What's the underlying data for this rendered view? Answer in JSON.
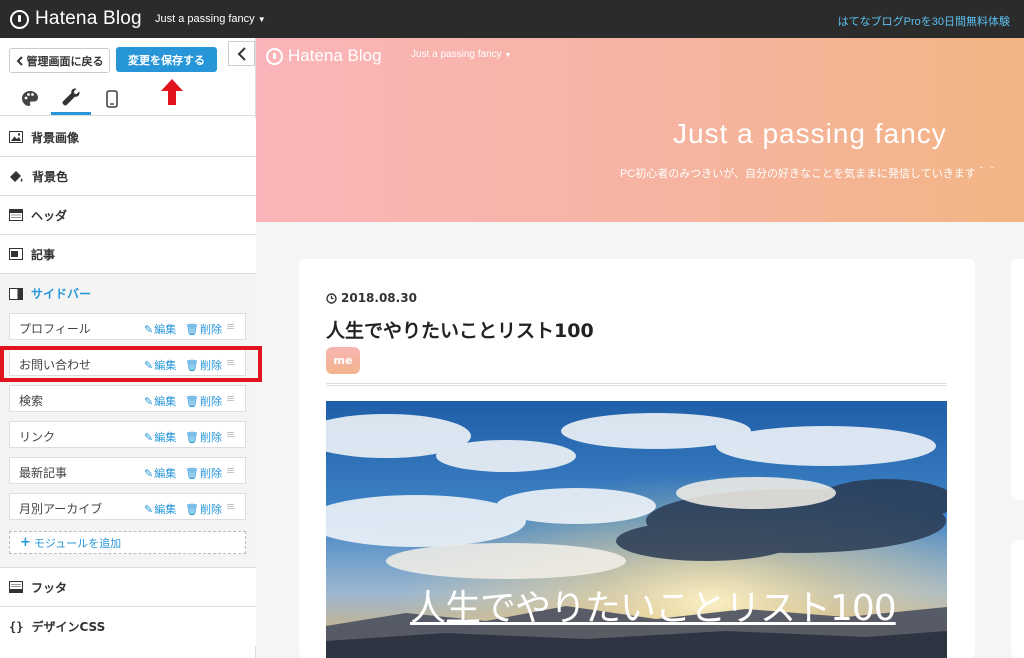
{
  "topbar": {
    "logo": "Hatena Blog",
    "blog_selector": "Just a passing fancy",
    "pro_link": "はてなブログProを30日間無料体験"
  },
  "panel": {
    "back_label": "管理画面に戻る",
    "save_label": "変更を保存する",
    "sections": {
      "bg_image": "背景画像",
      "bg_color": "背景色",
      "header": "ヘッダ",
      "article": "記事",
      "sidebar": "サイドバー",
      "footer": "フッタ",
      "design_css": "デザインCSS"
    },
    "modules": [
      {
        "name": "プロフィール",
        "edit": "編集",
        "delete": "削除"
      },
      {
        "name": "お問い合わせ",
        "edit": "編集",
        "delete": "削除"
      },
      {
        "name": "検索",
        "edit": "編集",
        "delete": "削除"
      },
      {
        "name": "リンク",
        "edit": "編集",
        "delete": "削除"
      },
      {
        "name": "最新記事",
        "edit": "編集",
        "delete": "削除"
      },
      {
        "name": "月別アーカイブ",
        "edit": "編集",
        "delete": "削除"
      }
    ],
    "add_module": "モジュールを追加"
  },
  "preview": {
    "logo": "Hatena Blog",
    "blog_selector": "Just a passing fancy",
    "blog_title": "Just a passing fancy",
    "blog_description": "PC初心者のみつきいが、自分の好きなことを気ままに発信していきます＾＾",
    "post": {
      "date": "2018.08.30",
      "title": "人生でやりたいことリスト100",
      "category": "me",
      "image_caption": "人生でやりたいことリスト100"
    }
  },
  "colors": {
    "accent": "#2796d9",
    "highlight": "#e0141e",
    "topbar": "#2b2b2b"
  }
}
